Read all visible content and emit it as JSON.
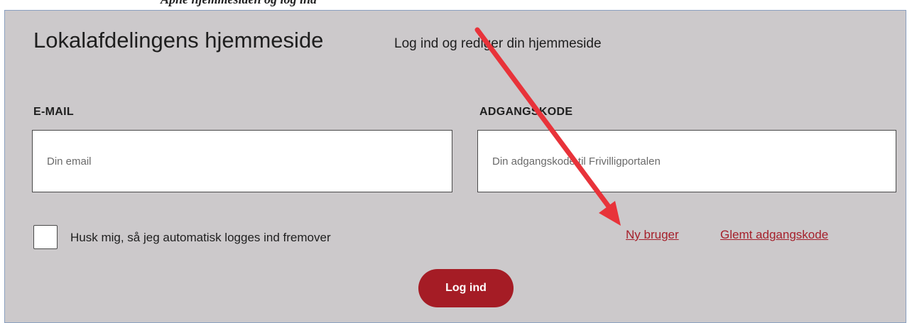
{
  "header_strip": {
    "cropped_text": "Åpne hjemmesiden og log ind"
  },
  "panel": {
    "title": "Lokalafdelingens hjemmeside",
    "subtitle": "Log ind og rediger din hjemmeside"
  },
  "form": {
    "email": {
      "label": "E-MAIL",
      "placeholder": "Din email",
      "value": ""
    },
    "password": {
      "label": "ADGANGSKODE",
      "placeholder": "Din adgangskode til Frivilligportalen",
      "value": ""
    },
    "remember_me": {
      "label": "Husk mig, så jeg automatisk logges ind fremover",
      "checked": false
    },
    "links": {
      "new_user": "Ny bruger",
      "forgot_password": "Glemt adgangskode"
    },
    "submit_label": "Log ind"
  },
  "annotation": {
    "arrow_color": "#e8333a",
    "points_to": "Ny bruger"
  },
  "colors": {
    "panel_bg": "#ccc9cb",
    "accent": "#a51c25",
    "link": "#a5202b"
  }
}
